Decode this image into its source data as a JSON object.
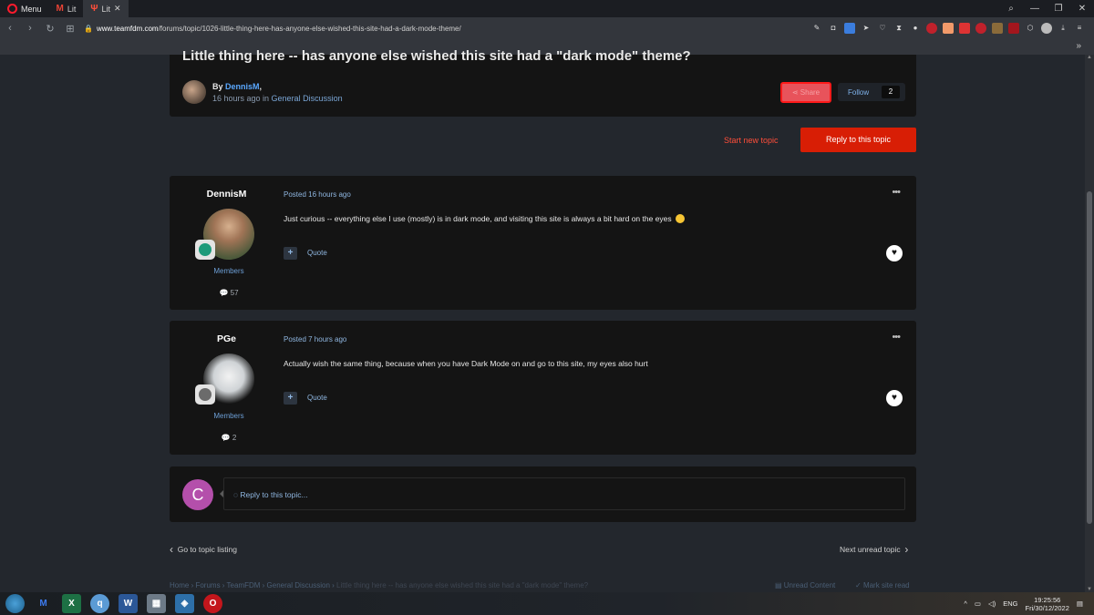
{
  "browser": {
    "menu_label": "Menu",
    "tabs": [
      {
        "icon": "M",
        "label": "Lit"
      },
      {
        "icon": "Ψ",
        "label": "Lit",
        "close": "✕"
      }
    ],
    "window_controls": [
      "⌕",
      "—",
      "❐",
      "✕"
    ],
    "url_host": "www.teamfdm.com",
    "url_path": "/forums/topic/1026-little-thing-here-has-anyone-else-wished-this-site-had-a-dark-mode-theme/",
    "bookmarks_more": "»"
  },
  "topic": {
    "title": "Little thing here -- has anyone else wished this site had a \"dark mode\" theme?",
    "by_prefix": "By ",
    "author": "DennisM",
    "by_suffix": ",",
    "time_ago": "16 hours ago in ",
    "category": "General Discussion",
    "share_label": "Share",
    "follow_label": "Follow",
    "follow_count": "2"
  },
  "actions": {
    "start_new_topic": "Start new topic",
    "reply_to_topic": "Reply to this topic"
  },
  "posts": [
    {
      "username": "DennisM",
      "group": "Members",
      "post_count": "57",
      "posted": "Posted 16 hours ago",
      "body": "Just curious -- everything else I use (mostly) is in dark mode, and visiting this site is always a bit hard on the eyes",
      "quote": "Quote"
    },
    {
      "username": "PGe",
      "group": "Members",
      "post_count": "2",
      "posted": "Posted 7 hours ago",
      "body": "Actually wish the same thing, because when you have Dark Mode on and go to this site, my eyes also hurt",
      "quote": "Quote"
    }
  ],
  "reply_box": {
    "avatar_letter": "C",
    "placeholder": "Reply to this topic..."
  },
  "navigation": {
    "go_to_listing": "Go to topic listing",
    "next_unread": "Next unread topic"
  },
  "breadcrumb": {
    "items": [
      "Home",
      "Forums",
      "TeamFDM",
      "General Discussion"
    ],
    "current": "Little thing here -- has anyone else wished this site had a \"dark mode\" theme?",
    "unread_content": "Unread Content",
    "mark_read": "Mark site read"
  },
  "taskbar": {
    "language": "ENG",
    "time": "19:25:56",
    "date": "Fri/30/12/2022"
  },
  "colors": {
    "accent_red": "#d81e05",
    "link_blue": "#5aa8ff",
    "page_bg": "#23272d",
    "card_bg": "#141414"
  }
}
